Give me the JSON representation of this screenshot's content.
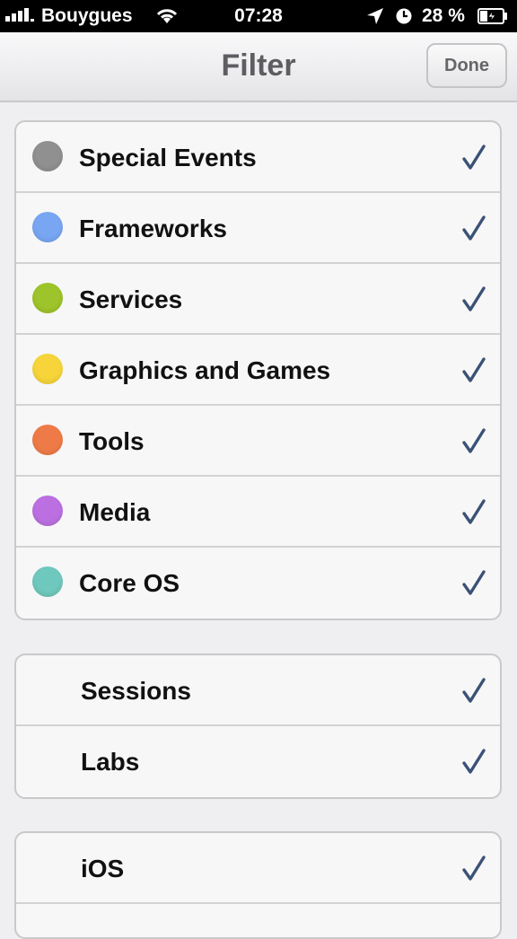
{
  "status_bar": {
    "carrier": "Bouygues",
    "time": "07:28",
    "battery": "28 %"
  },
  "nav": {
    "title": "Filter",
    "done_label": "Done"
  },
  "tracks": [
    {
      "label": "Special Events",
      "color": "#909090",
      "checked": true
    },
    {
      "label": "Frameworks",
      "color": "#78a6f2",
      "checked": true
    },
    {
      "label": "Services",
      "color": "#9dc42a",
      "checked": true
    },
    {
      "label": "Graphics and Games",
      "color": "#f6d43a",
      "checked": true
    },
    {
      "label": "Tools",
      "color": "#ee7b47",
      "checked": true
    },
    {
      "label": "Media",
      "color": "#bb6fe0",
      "checked": true
    },
    {
      "label": "Core OS",
      "color": "#6fc8bd",
      "checked": true
    }
  ],
  "types": [
    {
      "label": "Sessions",
      "checked": true
    },
    {
      "label": "Labs",
      "checked": true
    }
  ],
  "platforms": [
    {
      "label": "iOS",
      "checked": true
    }
  ],
  "check_color": "#3b5276"
}
